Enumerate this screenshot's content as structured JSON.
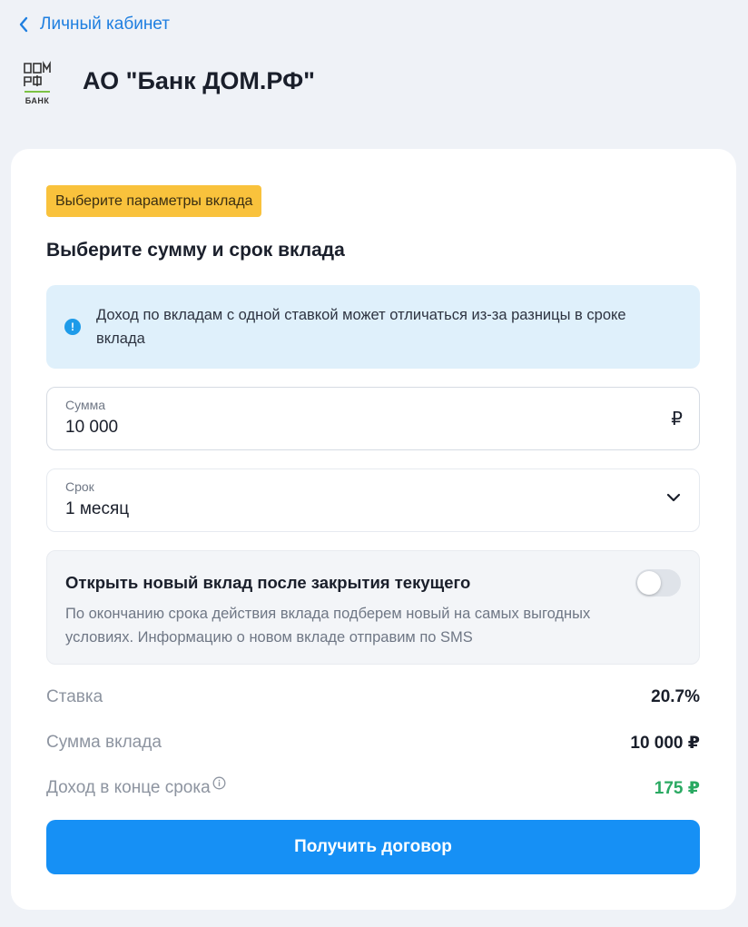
{
  "nav": {
    "back_label": "Личный кабинет"
  },
  "bank": {
    "logo_text": "БАНК",
    "title": "АО \"Банк ДОМ.РФ\""
  },
  "form": {
    "step_badge": "Выберите параметры вклада",
    "section_title": "Выберите сумму и срок вклада",
    "info_text": "Доход по вкладам с одной ставкой может отличаться из-за разницы в сроке вклада",
    "amount": {
      "label": "Сумма",
      "value": "10 000",
      "currency": "₽"
    },
    "term": {
      "label": "Срок",
      "value": "1 месяц"
    },
    "renew": {
      "title": "Открыть новый вклад после закрытия текущего",
      "description": "По окончанию срока действия вклада подберем новый на самых выгодных условиях. Информацию о новом вкладе отправим по SMS",
      "enabled": false
    }
  },
  "summary": {
    "rate_label": "Ставка",
    "rate_value": "20.7%",
    "sum_label": "Сумма вклада",
    "sum_value": "10 000 ₽",
    "income_label": "Доход в конце срока",
    "income_value": "175 ₽"
  },
  "actions": {
    "submit_label": "Получить договор"
  },
  "colors": {
    "accent": "#1690f5",
    "link": "#1f7fe0",
    "badge": "#f9c23c",
    "info_bg": "#dff0fb",
    "income": "#2aa962",
    "background": "#eff2f7"
  }
}
